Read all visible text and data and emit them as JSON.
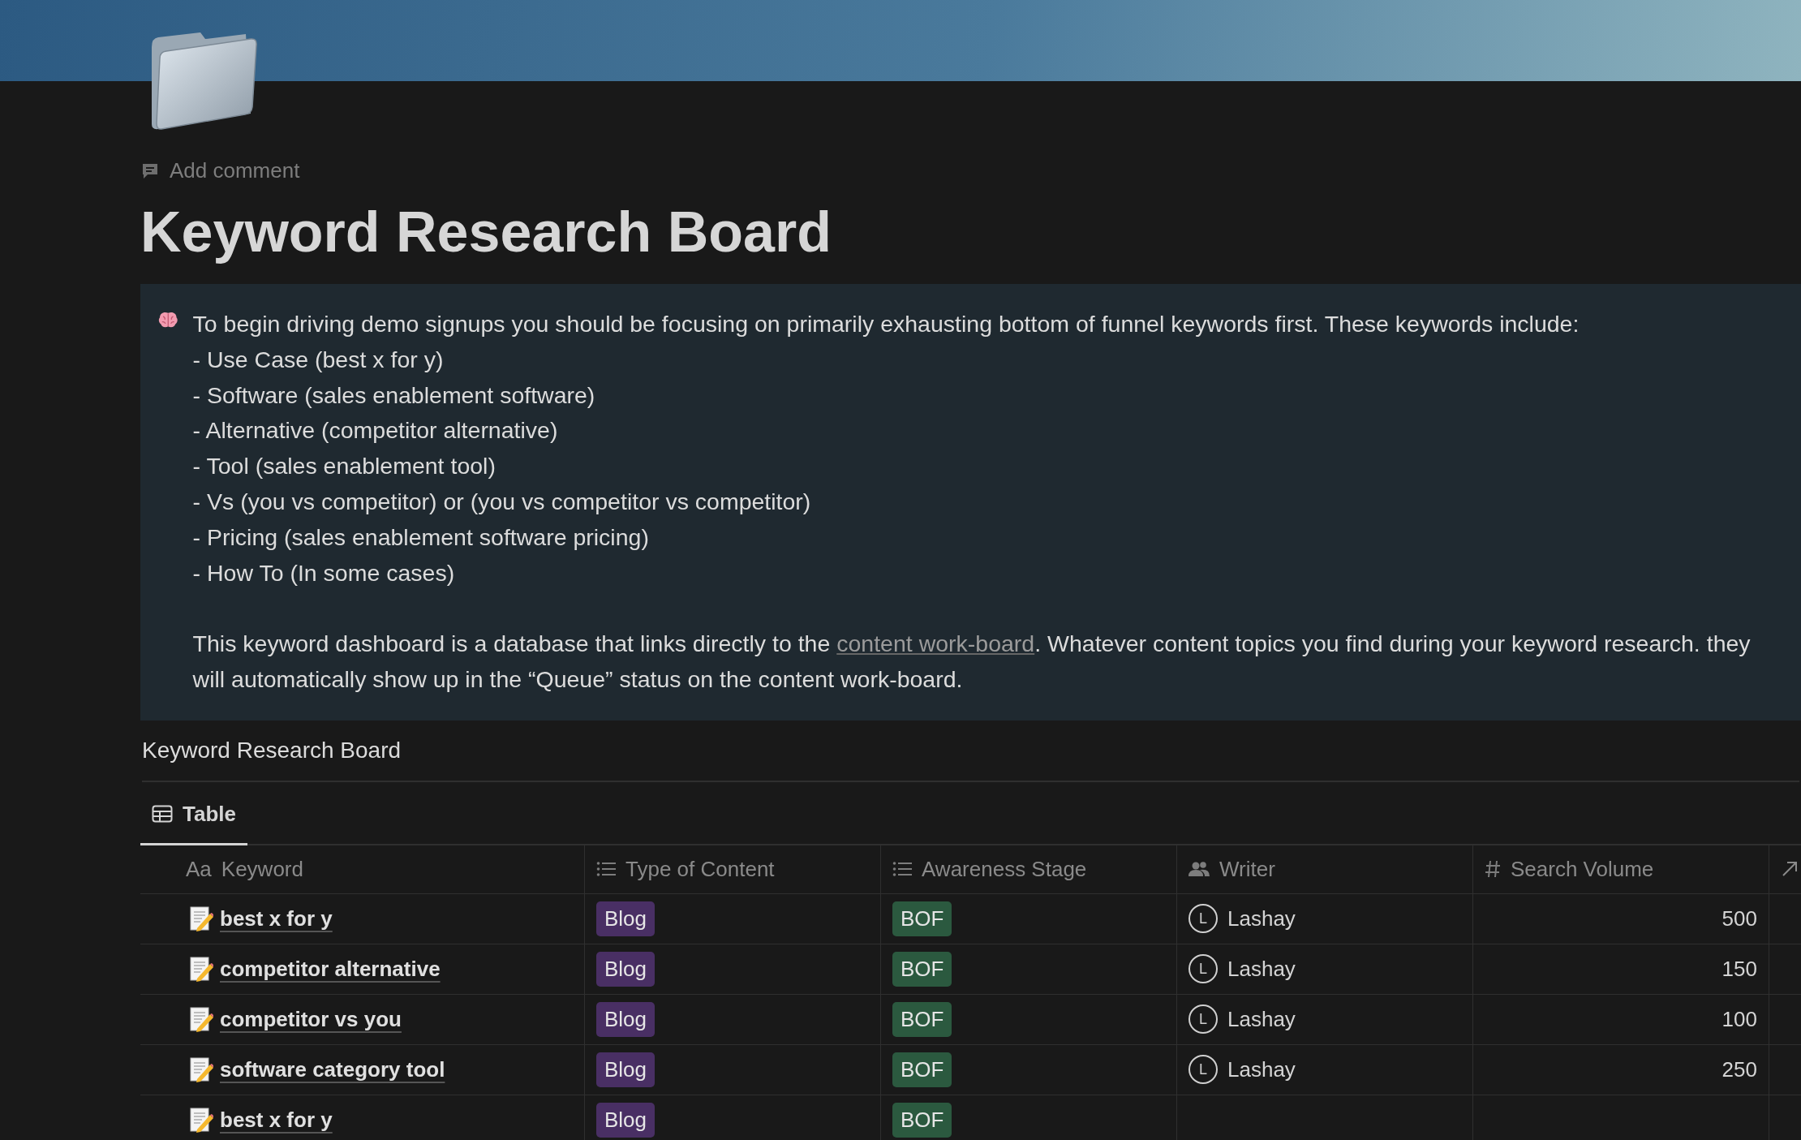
{
  "page": {
    "add_comment": "Add comment",
    "title": "Keyword Research Board"
  },
  "callout": {
    "lines": [
      "To begin driving demo signups you should be focusing on primarily exhausting bottom of funnel keywords first. These keywords include:",
      "- Use Case (best x for y)",
      "- Software (sales enablement software)",
      "- Alternative (competitor alternative)",
      "- Tool (sales enablement tool)",
      "- Vs (you vs competitor) or (you vs competitor vs competitor)",
      "- Pricing (sales enablement software pricing)",
      "- How To (In some cases)"
    ],
    "paragraph": {
      "before": "This keyword dashboard is a database that links directly to the ",
      "link": "content work-board",
      "after": ". Whatever content topics you find during your keyword research. they will automatically show up in the “Queue” status on the content work-board."
    }
  },
  "database": {
    "title": "Keyword Research Board",
    "tabs": [
      {
        "label": "Table",
        "selected": true
      }
    ],
    "columns": [
      {
        "kind": "title",
        "prefix": "Aa",
        "label": "Keyword"
      },
      {
        "kind": "select",
        "label": "Type of Content"
      },
      {
        "kind": "select",
        "label": "Awareness Stage"
      },
      {
        "kind": "person",
        "label": "Writer"
      },
      {
        "kind": "number",
        "label": "Search Volume"
      },
      {
        "kind": "relation"
      }
    ],
    "rows": [
      {
        "keyword": "best x for y",
        "type": {
          "label": "Blog",
          "color": "#492f64"
        },
        "stage": {
          "label": "BOF",
          "color": "#2b593f"
        },
        "writer": {
          "initial": "L",
          "name": "Lashay"
        },
        "volume": "500"
      },
      {
        "keyword": "competitor alternative",
        "type": {
          "label": "Blog",
          "color": "#492f64"
        },
        "stage": {
          "label": "BOF",
          "color": "#2b593f"
        },
        "writer": {
          "initial": "L",
          "name": "Lashay"
        },
        "volume": "150"
      },
      {
        "keyword": "competitor vs you",
        "type": {
          "label": "Blog",
          "color": "#492f64"
        },
        "stage": {
          "label": "BOF",
          "color": "#2b593f"
        },
        "writer": {
          "initial": "L",
          "name": "Lashay"
        },
        "volume": "100"
      },
      {
        "keyword": "software category tool",
        "type": {
          "label": "Blog",
          "color": "#492f64"
        },
        "stage": {
          "label": "BOF",
          "color": "#2b593f"
        },
        "writer": {
          "initial": "L",
          "name": "Lashay"
        },
        "volume": "250"
      },
      {
        "keyword": "best x for y",
        "type": {
          "label": "Blog",
          "color": "#492f64"
        },
        "stage": {
          "label": "BOF",
          "color": "#2b593f"
        }
      }
    ]
  }
}
